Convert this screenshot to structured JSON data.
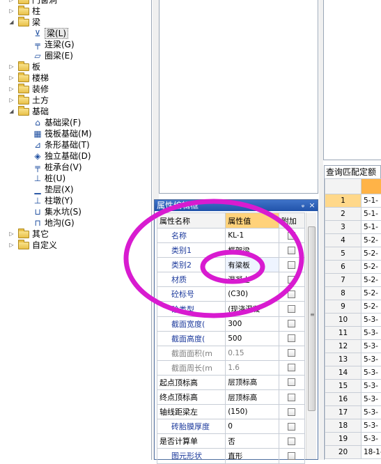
{
  "tree": {
    "items": [
      {
        "label": "门窗洞",
        "expander": "+"
      },
      {
        "label": "柱",
        "expander": "+"
      },
      {
        "label": "梁",
        "expander": "-"
      },
      {
        "label": "梁(L)",
        "icon": "beam-icon",
        "selected": true
      },
      {
        "label": "连梁(G)",
        "icon": "coupling-beam-icon"
      },
      {
        "label": "圈梁(E)",
        "icon": "ring-beam-icon"
      },
      {
        "label": "板",
        "expander": "+"
      },
      {
        "label": "楼梯",
        "expander": "+"
      },
      {
        "label": "装修",
        "expander": "+"
      },
      {
        "label": "土方",
        "expander": "+"
      },
      {
        "label": "基础",
        "expander": "-"
      },
      {
        "label": "基础梁(F)",
        "icon": "foundation-beam-icon"
      },
      {
        "label": "筏板基础(M)",
        "icon": "raft-foundation-icon"
      },
      {
        "label": "条形基础(T)",
        "icon": "strip-foundation-icon"
      },
      {
        "label": "独立基础(D)",
        "icon": "isolated-foundation-icon"
      },
      {
        "label": "桩承台(V)",
        "icon": "pile-cap-icon"
      },
      {
        "label": "桩(U)",
        "icon": "pile-icon"
      },
      {
        "label": "垫层(X)",
        "icon": "cushion-icon"
      },
      {
        "label": "柱墩(Y)",
        "icon": "column-pier-icon"
      },
      {
        "label": "集水坑(S)",
        "icon": "sump-pit-icon"
      },
      {
        "label": "地沟(G)",
        "icon": "trench-icon"
      },
      {
        "label": "其它",
        "expander": "+"
      },
      {
        "label": "自定义",
        "expander": "+"
      }
    ]
  },
  "property_panel": {
    "title": "属性编辑框",
    "pin_glyph": "ᵩ",
    "close_glyph": "×",
    "headers": {
      "name": "属性名称",
      "value": "属性值",
      "extra": "附加"
    },
    "rows": [
      {
        "name": "名称",
        "value": "KL-1",
        "style": "normal"
      },
      {
        "name": "类别1",
        "value": "框架梁",
        "style": "normal"
      },
      {
        "name": "类别2",
        "value": "有梁板",
        "style": "edit"
      },
      {
        "name": "材质",
        "value": "混凝土",
        "style": "normal"
      },
      {
        "name": "砼标号",
        "value": "(C30)",
        "style": "normal"
      },
      {
        "name": "砼类型",
        "value": "(现浇混凝",
        "style": "normal"
      },
      {
        "name": "截面宽度(",
        "value": "300",
        "style": "normal"
      },
      {
        "name": "截面高度(",
        "value": "500",
        "style": "normal"
      },
      {
        "name": "截面面积(m",
        "value": "0.15",
        "style": "gray"
      },
      {
        "name": "截面周长(m",
        "value": "1.6",
        "style": "gray"
      },
      {
        "name": "起点顶标高",
        "value": "层顶标高",
        "style": "black"
      },
      {
        "name": "终点顶标高",
        "value": "层顶标高",
        "style": "black"
      },
      {
        "name": "轴线距梁左",
        "value": "(150)",
        "style": "black"
      },
      {
        "name": "砖胎膜厚度",
        "value": "0",
        "style": "normal"
      },
      {
        "name": "是否计算单",
        "value": "否",
        "style": "black"
      },
      {
        "name": "图元形状",
        "value": "直形",
        "style": "normal"
      }
    ]
  },
  "query_panel": {
    "tab_label": "查询匹配定额",
    "rows": [
      {
        "n": "1",
        "v": "5-1-"
      },
      {
        "n": "2",
        "v": "5-1-"
      },
      {
        "n": "3",
        "v": "5-1-"
      },
      {
        "n": "4",
        "v": "5-2-"
      },
      {
        "n": "5",
        "v": "5-2-"
      },
      {
        "n": "6",
        "v": "5-2-"
      },
      {
        "n": "7",
        "v": "5-2-"
      },
      {
        "n": "8",
        "v": "5-2-"
      },
      {
        "n": "9",
        "v": "5-2-"
      },
      {
        "n": "10",
        "v": "5-3-"
      },
      {
        "n": "11",
        "v": "5-3-"
      },
      {
        "n": "12",
        "v": "5-3-"
      },
      {
        "n": "13",
        "v": "5-3-"
      },
      {
        "n": "14",
        "v": "5-3-"
      },
      {
        "n": "15",
        "v": "5-3-"
      },
      {
        "n": "16",
        "v": "5-3-"
      },
      {
        "n": "17",
        "v": "5-3-"
      },
      {
        "n": "18",
        "v": "5-3-"
      },
      {
        "n": "19",
        "v": "5-3-"
      },
      {
        "n": "20",
        "v": "18-1-"
      }
    ]
  },
  "colors": {
    "annotation": "#d81bd0",
    "title_bar": "#2a5cb3",
    "header_highlight": "#ffd27a"
  }
}
